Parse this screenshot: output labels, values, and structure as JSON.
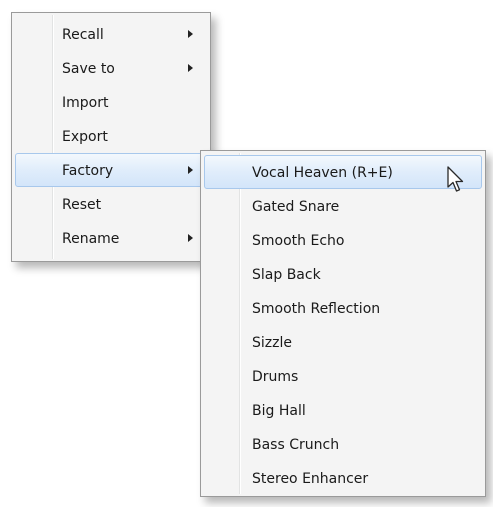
{
  "main_menu": {
    "items": [
      {
        "label": "Recall",
        "has_submenu": true
      },
      {
        "label": "Save to",
        "has_submenu": true
      },
      {
        "label": "Import",
        "has_submenu": false
      },
      {
        "label": "Export",
        "has_submenu": false
      },
      {
        "label": "Factory",
        "has_submenu": true,
        "highlighted": true
      },
      {
        "label": "Reset",
        "has_submenu": false
      },
      {
        "label": "Rename",
        "has_submenu": true
      }
    ]
  },
  "factory_submenu": {
    "items": [
      {
        "label": "Vocal Heaven (R+E)",
        "highlighted": true
      },
      {
        "label": "Gated Snare"
      },
      {
        "label": "Smooth Echo"
      },
      {
        "label": "Slap Back"
      },
      {
        "label": "Smooth Reflection"
      },
      {
        "label": "Sizzle"
      },
      {
        "label": "Drums"
      },
      {
        "label": "Big Hall"
      },
      {
        "label": "Bass Crunch"
      },
      {
        "label": "Stereo Enhancer"
      }
    ]
  },
  "colors": {
    "menu_background": "#f4f4f4",
    "highlight_border": "#a8c8ec",
    "highlight_fill": "#dbe9fa"
  },
  "icons": {
    "submenu_arrow": "chevron-right-icon",
    "pointer": "mouse-cursor-icon"
  }
}
